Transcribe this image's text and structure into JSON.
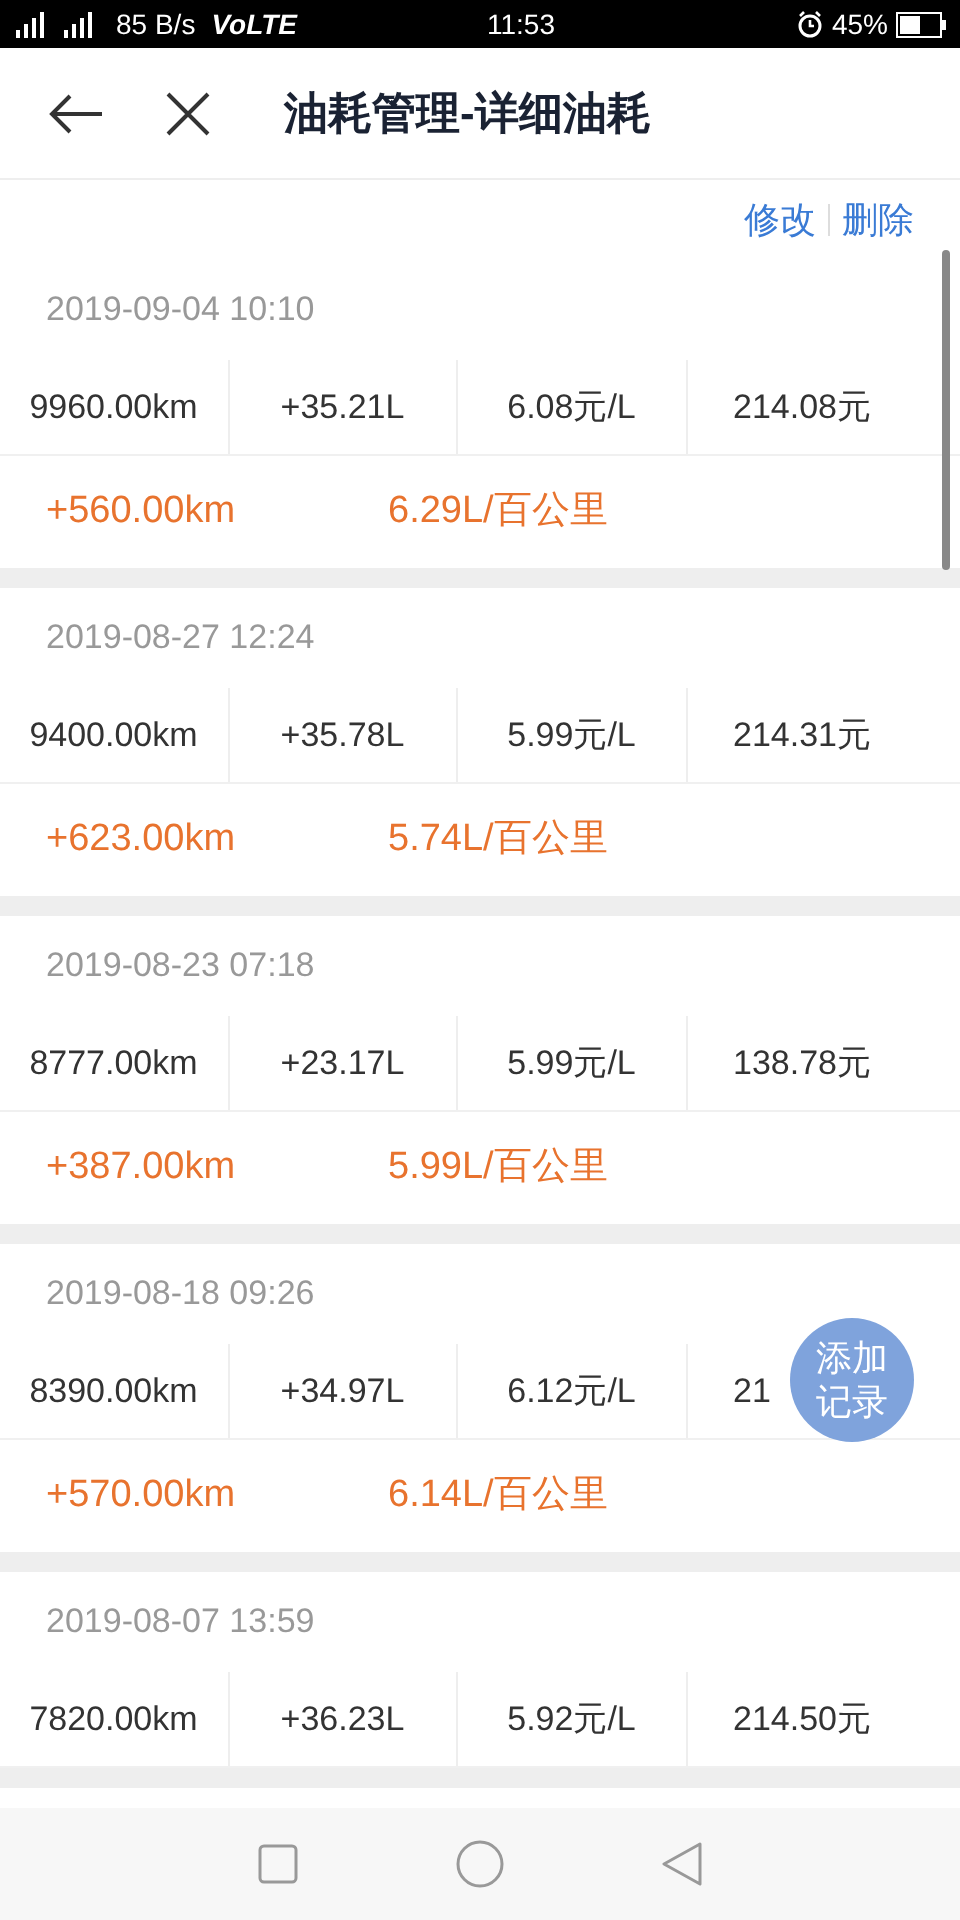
{
  "status_bar": {
    "speed": "85 B/s",
    "network": "VoLTE",
    "time": "11:53",
    "battery": "45%"
  },
  "header": {
    "title": "油耗管理-详细油耗"
  },
  "actions": [
    "修改",
    "删除"
  ],
  "records": [
    {
      "date": "2019-09-04 10:10",
      "odometer": "9960.00km",
      "fuel": "+35.21L",
      "price": "6.08元/L",
      "total": "214.08元",
      "distance": "+560.00km",
      "consumption": "6.29L/百公里"
    },
    {
      "date": "2019-08-27 12:24",
      "odometer": "9400.00km",
      "fuel": "+35.78L",
      "price": "5.99元/L",
      "total": "214.31元",
      "distance": "+623.00km",
      "consumption": "5.74L/百公里"
    },
    {
      "date": "2019-08-23 07:18",
      "odometer": "8777.00km",
      "fuel": "+23.17L",
      "price": "5.99元/L",
      "total": "138.78元",
      "distance": "+387.00km",
      "consumption": "5.99L/百公里"
    },
    {
      "date": "2019-08-18 09:26",
      "odometer": "8390.00km",
      "fuel": "+34.97L",
      "price": "6.12元/L",
      "total": "21",
      "distance": "+570.00km",
      "consumption": "6.14L/百公里"
    },
    {
      "date": "2019-08-07 13:59",
      "odometer": "7820.00km",
      "fuel": "+36.23L",
      "price": "5.92元/L",
      "total": "214.50元"
    }
  ],
  "fab": {
    "label_line1": "添加",
    "label_line2": "记录"
  }
}
